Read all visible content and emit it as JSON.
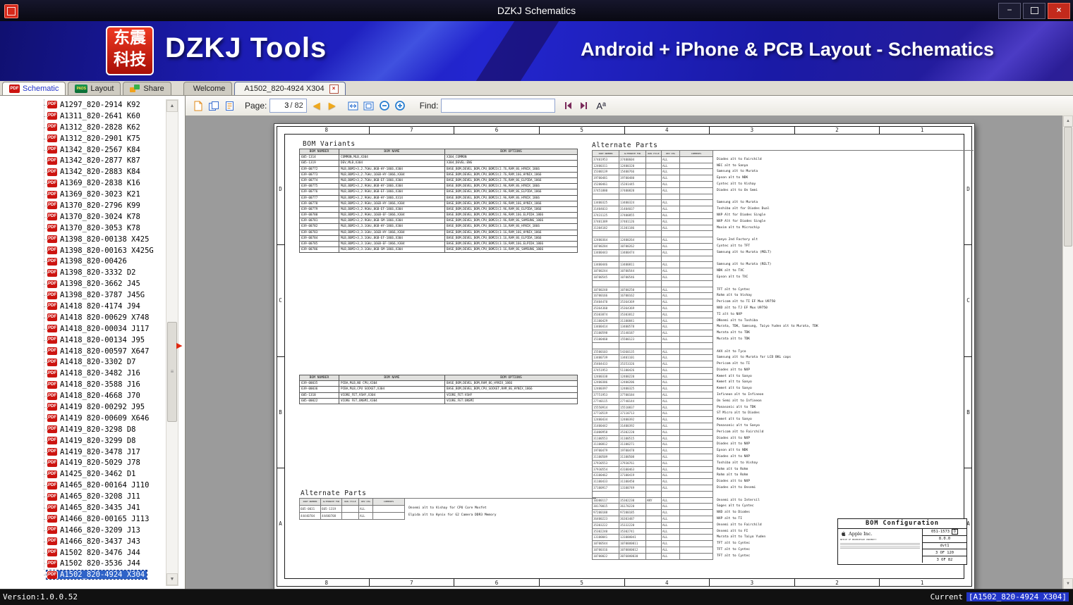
{
  "window": {
    "title": "DZKJ Schematics",
    "minimize_glyph": "−",
    "close_glyph": "×"
  },
  "banner": {
    "logo_line1": "东震",
    "logo_line2": "科技",
    "app_name": "DZKJ Tools",
    "tagline": "Android + iPhone & PCB Layout - Schematics"
  },
  "icons": {
    "pdf_badge": "PDF",
    "pads_badge": "PADS",
    "prev_page": "◀",
    "next_page": "▶",
    "scroll_up": "▲",
    "scroll_down": "▼",
    "thumb_grip": "≡",
    "collapse": "▶",
    "font_size": "Aª"
  },
  "tabbar": {
    "tool_tabs": [
      {
        "label": "Schematic"
      },
      {
        "label": "Layout"
      },
      {
        "label": "Share"
      }
    ],
    "doc_tabs": [
      {
        "label": "Welcome"
      },
      {
        "label": "A1502_820-4924 X304"
      }
    ]
  },
  "toolbar": {
    "page_label": "Page:",
    "page_value": "3",
    "page_total": "/ 82",
    "find_label": "Find:",
    "find_value": ""
  },
  "sidebar": {
    "selected_index": 42,
    "items": [
      "A1297_820-2914 K92",
      "A1311_820-2641 K60",
      "A1312_820-2828 K62",
      "A1312_820-2901 K75",
      "A1342_820-2567 K84",
      "A1342_820-2877 K87",
      "A1342_820-2883 K84",
      "A1369_820-2838 K16",
      "A1369_820-3023 K21",
      "A1370_820-2796 K99",
      "A1370_820-3024 K78",
      "A1370_820-3053 K78",
      "A1398_820-00138 X425",
      "A1398_820-00163 X425G",
      "A1398_820-00426",
      "A1398_820-3332 D2",
      "A1398_820-3662 J45",
      "A1398_820-3787 J45G",
      "A1418 820-4174 J94",
      "A1418 820-00629 X748",
      "A1418_820-00034 J117",
      "A1418_820-00134 J95",
      "A1418_820-00597 X647",
      "A1418_820-3302 D7",
      "A1418_820-3482 J16",
      "A1418_820-3588 J16",
      "A1418_820-4668 J70",
      "A1419 820-00292 J95",
      "A1419 820-00609 X646",
      "A1419_820-3298 D8",
      "A1419_820-3299 D8",
      "A1419_820-3478 J17",
      "A1419_820-5029 J78",
      "A1425_820-3462 D1",
      "A1465_820-00164 J110",
      "A1465_820-3208 J11",
      "A1465_820-3435 J41",
      "A1466_820-00165 J113",
      "A1466_820-3209 J13",
      "A1466_820-3437 J43",
      "A1502 820-3476 J44",
      "A1502 820-3536 J44",
      "A1502_820-4924 X304"
    ]
  },
  "document": {
    "zones_h": [
      "8",
      "7",
      "6",
      "5",
      "4",
      "3",
      "2",
      "1"
    ],
    "zones_v": [
      "D",
      "C",
      "B",
      "A"
    ],
    "bom_variants": {
      "title": "BOM Variants",
      "headers": [
        "BOM NUMBER",
        "BOM NAME",
        "BOM OPTIONS"
      ],
      "rows": [
        [
          "605-1314",
          "COMMON,MLB,X304",
          "X304_COMMON"
        ],
        [
          "605-1319",
          "DEV,MLB,X304",
          "X304_DEVEL:ENG"
        ],
        [
          "639-00772",
          "MLB,BOM2+3,2.7GHz,8GB-HY-1866,X304",
          "BASE_BOM,DEVEL_BOM,CPU_BOM23(2.7G,RAM_8G_HYNIX_1866"
        ],
        [
          "639-00773",
          "MLB,BOM2+3,2.7GHz,16GB-HY-1866,X304",
          "BASE_BOM,DEVEL_BOM,CPU_BOM23(2.7G,RAM_16G_HYNIX_1866"
        ],
        [
          "639-00774",
          "MLB,BOM2+3,2.7GHz,8GB-EF-1866,X304",
          "BASE_BOM,DEVEL_BOM,CPU_BOM23(2.7G,RAM_8G_ELPIDA_1866"
        ],
        [
          "639-00775",
          "MLB,BOM2+3,2.9GHz,8GB-HY-1866,X304",
          "BASE_BOM,DEVEL_BOM,CPU_BOM23(2.9G,RAM_8G_HYNIX_1866"
        ],
        [
          "639-00776",
          "MLB,BOM2+3,2.9GHz,8GB-EF-1866,X304",
          "BASE_BOM,DEVEL_BOM,CPU_BOM23(2.9G,RAM_8G_ELPIDA_1866"
        ],
        [
          "639-00777",
          "MLB,BOM2+3,2.9GHz,8GB-HY-1866,X314",
          "BASE_BOM,DEVEL_BOM,CPU_BOM23(2.9G,RAM_8G_HYNIX_1866"
        ],
        [
          "639-00778",
          "MLB,BOM2+3,2.9GHz,16GB-HY-1866,X304",
          "BASE_BOM,DEVEL_BOM,CPU_BOM23(2.9G,RAM_16G_HYNIX_1866"
        ],
        [
          "639-00779",
          "MLB,BOM2+3,2.9GHz,8GB-EF-1866,X304",
          "BASE_BOM,DEVEL_BOM,CPU_BOM23(2.9G,RAM_8G_ELPIDA_1866"
        ],
        [
          "639-00780",
          "MLB,BOM2+3,2.9GHz,16GB-EF-1866,X304",
          "BASE_BOM,DEVEL_BOM,CPU_BOM23(2.9G,RAM_16G_ELPIDA_1866"
        ],
        [
          "639-00781",
          "MLB,BOM2+3,2.9GHz,8GB-SM-1866,X304",
          "BASE_BOM,DEVEL_BOM,CPU_BOM23(2.9G,RAM_8G_SAMSUNG_1866"
        ],
        [
          "639-00782",
          "MLB,BOM2+3,3.1GHz,8GB-HY-1866,X304",
          "BASE_BOM,DEVEL_BOM,CPU_BOM23(3.1G,RAM_8G_HYNIX_1866"
        ],
        [
          "639-00783",
          "MLB,BOM2+3,3.1GHz,16GB-HY-1866,X304",
          "BASE_BOM,DEVEL_BOM,CPU_BOM23(3.1G,RAM_16G_HYNIX_1866"
        ],
        [
          "639-00784",
          "MLB,BOM2+3,3.1GHz,8GB-EF-1866,X304",
          "BASE_BOM,DEVEL_BOM,CPU_BOM23(3.1G,RAM_8G_ELPIDA_1866"
        ],
        [
          "639-00785",
          "MLB,BOM2+3,3.1GHz,16GB-EF-1866,X304",
          "BASE_BOM,DEVEL_BOM,CPU_BOM23(3.1G,RAM_16G_ELPIDA_1866"
        ],
        [
          "639-00786",
          "MLB,BOM2+3,3.1GHz,8GB-SM-1866,X304",
          "BASE_BOM,DEVEL_BOM,CPU_BOM23(3.1G,RAM_8G_SAMSUNG_1866"
        ]
      ]
    },
    "bom_variants2": {
      "headers": [
        "BOM NUMBER",
        "BOM NAME",
        "BOM OPTIONS"
      ],
      "rows": [
        [
          "639-00035",
          "PCBA,MLB,NO CPU,X304",
          "BASE_BOM,DEVEL_BOM,RAM_8G_HYNIX_1866"
        ],
        [
          "639-00036",
          "PCBA,MLB,CPU SOCKET,X304",
          "BASE_BOM,DEVEL_BOM,CPU_SOCKET,RAM_8G_HYNIX_1866"
        ],
        [
          "605-1318",
          "VCORE_FET,VSHY,X304",
          "VCORE_FET:VSHY"
        ],
        [
          "605-00022",
          "VCORE FET,ONSMI,X304",
          "VCORE_FET:ONSMI"
        ]
      ]
    },
    "alt_parts_left": {
      "title": "Alternate Parts",
      "headers": [
        "PART NUMBER",
        "ALTERNATE FOR",
        "RUN CYCLE",
        "REV CHG",
        "COMMENTS"
      ],
      "rows": [
        {
          "c": [
            "605-0031",
            "605-1319",
            "",
            "ALL",
            ""
          ],
          "m": "Onsemi alt to Vishay for CPU Core Mosfet"
        },
        {
          "c": [
            "44440704",
            "44400708",
            "",
            "ALL",
            ""
          ],
          "m": "Elpida alt to Hynix for G2 Camera DDR3 Memory"
        }
      ]
    },
    "alt_parts_right": {
      "title": "Alternate Parts",
      "headers": [
        "PART NUMBER",
        "ALTERNATE FOR",
        "RUN CYCLE",
        "REV CHG",
        "COMMENTS"
      ],
      "rows": [
        {
          "c": [
            "37401953",
            "37400604",
            "",
            "ALL",
            ""
          ],
          "m": "Diodes alt to Fairchild"
        },
        {
          "c": [
            "12400311",
            "12400320",
            "",
            "ALL",
            ""
          ],
          "m": "NEC alt to Sanyo"
        },
        {
          "c": [
            "15300139",
            "15400766",
            "",
            "ALL",
            ""
          ],
          "m": "Samsung alt to Murata"
        },
        {
          "c": [
            "19700481",
            "19700480",
            "",
            "ALL",
            ""
          ],
          "m": "Epson alt to NDK"
        },
        {
          "c": [
            "15200461",
            "15201445",
            "",
            "ALL",
            ""
          ],
          "m": "Cyntec alt to Vishay"
        },
        {
          "c": [
            "37451880",
            "37400820",
            "",
            "ALL",
            ""
          ],
          "m": "Diodes alt to On Semi"
        },
        {
          "c": [
            "",
            "",
            "",
            "",
            ""
          ],
          "m": ""
        },
        {
          "c": [
            "13400325",
            "13400324",
            "",
            "ALL",
            ""
          ],
          "m": "Samsung alt to Murata"
        },
        {
          "c": [
            "31404033",
            "31404037",
            "",
            "ALL",
            ""
          ],
          "m": "Toshiba alt for Diodes Dual"
        },
        {
          "c": [
            "37431125",
            "37400855",
            "",
            "ALL",
            ""
          ],
          "m": "NXP Alt for Diodes Single"
        },
        {
          "c": [
            "37401389",
            "37401126",
            "",
            "ALL",
            ""
          ],
          "m": "NXP Alt for Diodes Single"
        },
        {
          "c": [
            "31304182",
            "31301186",
            "",
            "ALL",
            ""
          ],
          "m": "Maxim alt to Microchip"
        },
        {
          "c": [
            "",
            "",
            "",
            "",
            ""
          ],
          "m": ""
        },
        {
          "c": [
            "12400364",
            "12400264",
            "",
            "ALL",
            ""
          ],
          "m": "Sanyo 2nd Factory alt"
        },
        {
          "c": [
            "10700284",
            "10700262",
            "",
            "ALL",
            ""
          ],
          "m": "Cyntec alt to TFT"
        },
        {
          "c": [
            "13400443",
            "13400474",
            "",
            "ALL",
            ""
          ],
          "m": "Samsung alt to Murata (MELT)"
        },
        {
          "c": [
            "",
            "",
            "",
            "",
            ""
          ],
          "m": ""
        },
        {
          "c": [
            "13400446",
            "13400811",
            "",
            "ALL",
            ""
          ],
          "m": "Samsung alt to Murata (RELT)"
        },
        {
          "c": [
            "10700244",
            "10700544",
            "",
            "ALL",
            ""
          ],
          "m": "NDK alt to TXC"
        },
        {
          "c": [
            "10700545",
            "10700546",
            "",
            "ALL",
            ""
          ],
          "m": "Epson alt to TXC"
        },
        {
          "c": [
            "",
            "",
            "",
            "",
            ""
          ],
          "m": ""
        },
        {
          "c": [
            "10700248",
            "10700250",
            "",
            "ALL",
            ""
          ],
          "m": "TFT alt to Cyntec"
        },
        {
          "c": [
            "16700166",
            "16700162",
            "",
            "ALL",
            ""
          ],
          "m": "Rohm alt to Vishay"
        },
        {
          "c": [
            "35404470",
            "35364369",
            "",
            "ALL",
            ""
          ],
          "m": "Pericom alt to TI EF Mux U9750"
        },
        {
          "c": [
            "35364360",
            "35364369",
            "",
            "ALL",
            ""
          ],
          "m": "NXD alt to TJ EF Mux U9750"
        },
        {
          "c": [
            "35303874",
            "35303812",
            "",
            "ALL",
            ""
          ],
          "m": "TI alt to NXP"
        },
        {
          "c": [
            "31100429",
            "31100841",
            "",
            "ALL",
            ""
          ],
          "m": "ONsemi alt to Toshiba"
        },
        {
          "c": [
            "13400414",
            "13400578",
            "",
            "ALL",
            ""
          ],
          "m": "Murata, TDK, Samsung, Taiyo Yuden alt to Murata, TDK"
        },
        {
          "c": [
            "15100598",
            "15140187",
            "",
            "ALL",
            ""
          ],
          "m": "Murata alt to TDK"
        },
        {
          "c": [
            "15100460",
            "15500123",
            "",
            "ALL",
            ""
          ],
          "m": "Murata alt to TDK"
        },
        {
          "c": [
            "",
            "",
            "",
            "",
            ""
          ],
          "m": ""
        },
        {
          "c": [
            "15500103",
            "54360135",
            "",
            "ALL",
            ""
          ],
          "m": "AVX alt to Tyco"
        },
        {
          "c": [
            "13400739",
            "13401101",
            "",
            "ALL",
            ""
          ],
          "m": "Samsung alt to Murata for LCD BKL caps"
        },
        {
          "c": [
            "35404433",
            "35353326",
            "",
            "ALL",
            ""
          ],
          "m": "Pericom alt to TI"
        },
        {
          "c": [
            "37451953",
            "51100426",
            "",
            "ALL",
            ""
          ],
          "m": "Diodes alt to NXP"
        },
        {
          "c": [
            "12400338",
            "12400220",
            "",
            "ALL",
            ""
          ],
          "m": "Kemet alt to Sanyo"
        },
        {
          "c": [
            "12400386",
            "12400206",
            "",
            "ALL",
            ""
          ],
          "m": "Kemet alt to Sanyo"
        },
        {
          "c": [
            "12400397",
            "12400325",
            "",
            "ALL",
            ""
          ],
          "m": "Kemet alt to Sanyo"
        },
        {
          "c": [
            "37751953",
            "37700184",
            "",
            "ALL",
            ""
          ],
          "m": "Infineon alt to Infineon"
        },
        {
          "c": [
            "27740115",
            "27740144",
            "",
            "ALL",
            ""
          ],
          "m": "On Semi alt to Infineon"
        },
        {
          "c": [
            "15550914",
            "15510837",
            "",
            "ALL",
            ""
          ],
          "m": "Panasonic alt to TDK"
        },
        {
          "c": [
            "37710519",
            "37110713",
            "",
            "ALL",
            ""
          ],
          "m": "ST Micro alt to Diodes"
        },
        {
          "c": [
            "12400434",
            "12400392",
            "",
            "ALL",
            ""
          ],
          "m": "Kemet alt to Sanyo"
        },
        {
          "c": [
            "31400442",
            "31400392",
            "",
            "ALL",
            ""
          ],
          "m": "Panasonic alt to Sanyo"
        },
        {
          "c": [
            "31000958",
            "35302220",
            "",
            "ALL",
            ""
          ],
          "m": "Pericom alt to Fairchild"
        },
        {
          "c": [
            "31100553",
            "31100515",
            "",
            "ALL",
            ""
          ],
          "m": "Diodes alt to NXP"
        },
        {
          "c": [
            "31100812",
            "31100271",
            "",
            "ALL",
            ""
          ],
          "m": "Diodes alt to NXP"
        },
        {
          "c": [
            "19700479",
            "19700478",
            "",
            "ALL",
            ""
          ],
          "m": "Epson alt to NDK"
        },
        {
          "c": [
            "31100509",
            "31100508",
            "",
            "ALL",
            ""
          ],
          "m": "Diodes alt to NXP"
        },
        {
          "c": [
            "37930553",
            "37930761",
            "",
            "ALL",
            ""
          ],
          "m": "Toshiba alt to Vishay"
        },
        {
          "c": [
            "37930554",
            "43100463",
            "",
            "ALL",
            ""
          ],
          "m": "Rohm alt to Rohm"
        },
        {
          "c": [
            "43100462",
            "37100419",
            "",
            "ALL",
            ""
          ],
          "m": "Rohm alt to Rohm"
        },
        {
          "c": [
            "31100433",
            "31100450",
            "",
            "ALL",
            ""
          ],
          "m": "Diodes alt to NXP"
        },
        {
          "c": [
            "37100917",
            "13100749",
            "",
            "ALL",
            ""
          ],
          "m": "Diodes alt to Onsemi"
        },
        {
          "c": [
            "",
            "",
            "",
            "",
            ""
          ],
          "m": ""
        },
        {
          "c": [
            "10300117",
            "35302230",
            "ANY",
            "ALL",
            ""
          ],
          "m": "Onsemi alt to Intersil"
        },
        {
          "c": [
            "30170015",
            "36170220",
            "",
            "ALL",
            ""
          ],
          "m": "Sages alt to Cyntec"
        },
        {
          "c": [
            "97200188",
            "97200185",
            "",
            "ALL",
            ""
          ],
          "m": "NXD alt to Diodes"
        },
        {
          "c": [
            "36400223",
            "36303487",
            "",
            "ALL",
            ""
          ],
          "m": "NXP alt to TI"
        },
        {
          "c": [
            "35303222",
            "35332220",
            "",
            "ALL",
            ""
          ],
          "m": "Onsemi alt to Fairchild"
        },
        {
          "c": [
            "35302240",
            "35302741",
            "",
            "ALL",
            ""
          ],
          "m": "Onsemi alt to FI"
        },
        {
          "c": [
            "13100041",
            "13100U041",
            "",
            "ALL",
            ""
          ],
          "m": "Murata alt to Taiyo Yuden"
        },
        {
          "c": [
            "10700544",
            "10700U0011",
            "",
            "ALL",
            ""
          ],
          "m": "TFT alt to Cyntec"
        },
        {
          "c": [
            "10700316",
            "10700U0012",
            "",
            "ALL",
            ""
          ],
          "m": "TFT alt to Cyntec"
        },
        {
          "c": [
            "10700022",
            "30760U0030",
            "",
            "ALL",
            ""
          ],
          "m": "TFT alt to Cyntec"
        }
      ]
    },
    "bom_config": {
      "title": "BOM Configuration",
      "company": "Apple Inc.",
      "drawing_number": "051-1573",
      "rev": "D",
      "version": "8.0.0",
      "stage": "dvt1",
      "sheet_of_total": "3 OF 120",
      "page_of_total": "3 OF 82",
      "notice": "NOTICE OF PROPRIETARY PROPERTY:"
    }
  },
  "statusbar": {
    "version": "Version:1.0.0.52",
    "current_label": "Current",
    "current_doc": "[A1502_820-4924 X304]"
  }
}
